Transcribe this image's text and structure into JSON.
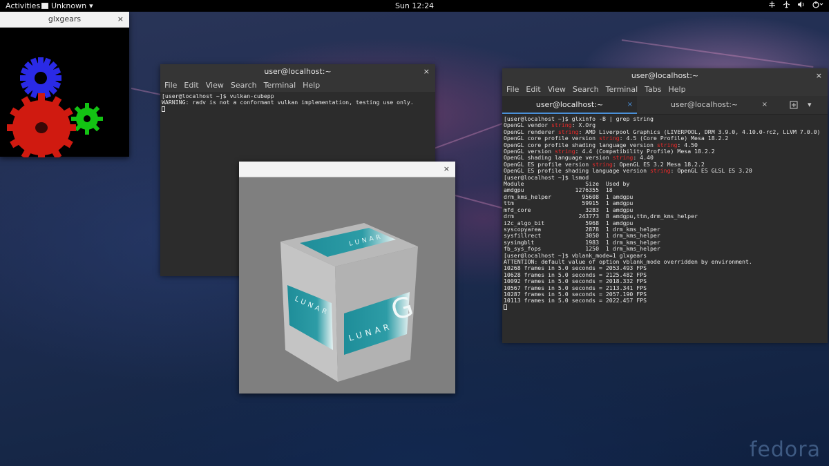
{
  "topbar": {
    "activities": "Activities",
    "app_menu": "Unknown",
    "clock": "Sun 12:24",
    "tray_icons": [
      "network-icon",
      "airplane-mode-icon",
      "volume-icon",
      "power-icon"
    ]
  },
  "glxgears_window": {
    "title": "glxgears",
    "close": "×",
    "gear_colors": {
      "red": "#d01a10",
      "green": "#13c313",
      "blue": "#2a2ae6"
    }
  },
  "terminal_left": {
    "title": "user@localhost:~",
    "close": "×",
    "menu": [
      "File",
      "Edit",
      "View",
      "Search",
      "Terminal",
      "Help"
    ],
    "lines": [
      "[user@localhost ~]$ vulkan-cubepp",
      "WARNING: radv is not a conformant vulkan implementation, testing use only."
    ]
  },
  "terminal_right": {
    "title": "user@localhost:~",
    "close": "×",
    "menu": [
      "File",
      "Edit",
      "View",
      "Search",
      "Terminal",
      "Tabs",
      "Help"
    ],
    "tabs": [
      {
        "label": "user@localhost:~",
        "close": "×",
        "active": true
      },
      {
        "label": "user@localhost:~",
        "close": "×",
        "active": false
      }
    ],
    "new_tab": "+",
    "tab_menu": "▾",
    "lines": [
      [
        {
          "t": "[user@localhost ~]$ glxinfo -B | grep string"
        }
      ],
      [
        {
          "t": "OpenGL vendor "
        },
        {
          "t": "string",
          "red": true
        },
        {
          "t": ": X.Org"
        }
      ],
      [
        {
          "t": "OpenGL renderer "
        },
        {
          "t": "string",
          "red": true
        },
        {
          "t": ": AMD Liverpool Graphics (LIVERPOOL, DRM 3.9.0, 4.10.0-rc2, LLVM 7.0.0)"
        }
      ],
      [
        {
          "t": "OpenGL core profile version "
        },
        {
          "t": "string",
          "red": true
        },
        {
          "t": ": 4.5 (Core Profile) Mesa 18.2.2"
        }
      ],
      [
        {
          "t": "OpenGL core profile shading language version "
        },
        {
          "t": "string",
          "red": true
        },
        {
          "t": ": 4.50"
        }
      ],
      [
        {
          "t": "OpenGL version "
        },
        {
          "t": "string",
          "red": true
        },
        {
          "t": ": 4.4 (Compatibility Profile) Mesa 18.2.2"
        }
      ],
      [
        {
          "t": "OpenGL shading language version "
        },
        {
          "t": "string",
          "red": true
        },
        {
          "t": ": 4.40"
        }
      ],
      [
        {
          "t": "OpenGL ES profile version "
        },
        {
          "t": "string",
          "red": true
        },
        {
          "t": ": OpenGL ES 3.2 Mesa 18.2.2"
        }
      ],
      [
        {
          "t": "OpenGL ES profile shading language version "
        },
        {
          "t": "string",
          "red": true
        },
        {
          "t": ": OpenGL ES GLSL ES 3.20"
        }
      ],
      [
        {
          "t": "[user@localhost ~]$ lsmod"
        }
      ],
      [
        {
          "t": "Module                  Size  Used by"
        }
      ],
      [
        {
          "t": "amdgpu               1276355  18"
        }
      ],
      [
        {
          "t": "drm_kms_helper         95608  1 amdgpu"
        }
      ],
      [
        {
          "t": "ttm                    59915  1 amdgpu"
        }
      ],
      [
        {
          "t": "mfd_core                3283  1 amdgpu"
        }
      ],
      [
        {
          "t": "drm                   243773  8 amdgpu,ttm,drm_kms_helper"
        }
      ],
      [
        {
          "t": "i2c_algo_bit            5968  1 amdgpu"
        }
      ],
      [
        {
          "t": "syscopyarea             2878  1 drm_kms_helper"
        }
      ],
      [
        {
          "t": "sysfillrect             3050  1 drm_kms_helper"
        }
      ],
      [
        {
          "t": "sysimgblt               1983  1 drm_kms_helper"
        }
      ],
      [
        {
          "t": "fb_sys_fops             1250  1 drm_kms_helper"
        }
      ],
      [
        {
          "t": "[user@localhost ~]$ vblank_mode=1 glxgears"
        }
      ],
      [
        {
          "t": "ATTENTION: default value of option vblank_mode overridden by environment."
        }
      ],
      [
        {
          "t": "10268 frames in 5.0 seconds = 2053.493 FPS"
        }
      ],
      [
        {
          "t": "10628 frames in 5.0 seconds = 2125.482 FPS"
        }
      ],
      [
        {
          "t": "10092 frames in 5.0 seconds = 2018.332 FPS"
        }
      ],
      [
        {
          "t": "10567 frames in 5.0 seconds = 2113.341 FPS"
        }
      ],
      [
        {
          "t": "10287 frames in 5.0 seconds = 2057.190 FPS"
        }
      ],
      [
        {
          "t": "10113 frames in 5.0 seconds = 2022.457 FPS"
        }
      ]
    ]
  },
  "cube_window": {
    "close": "×",
    "face_text": "LUNAR",
    "face_letter": "G",
    "face_color": "#1f8a96"
  },
  "wallpaper": {
    "logo_text": "fedora"
  }
}
